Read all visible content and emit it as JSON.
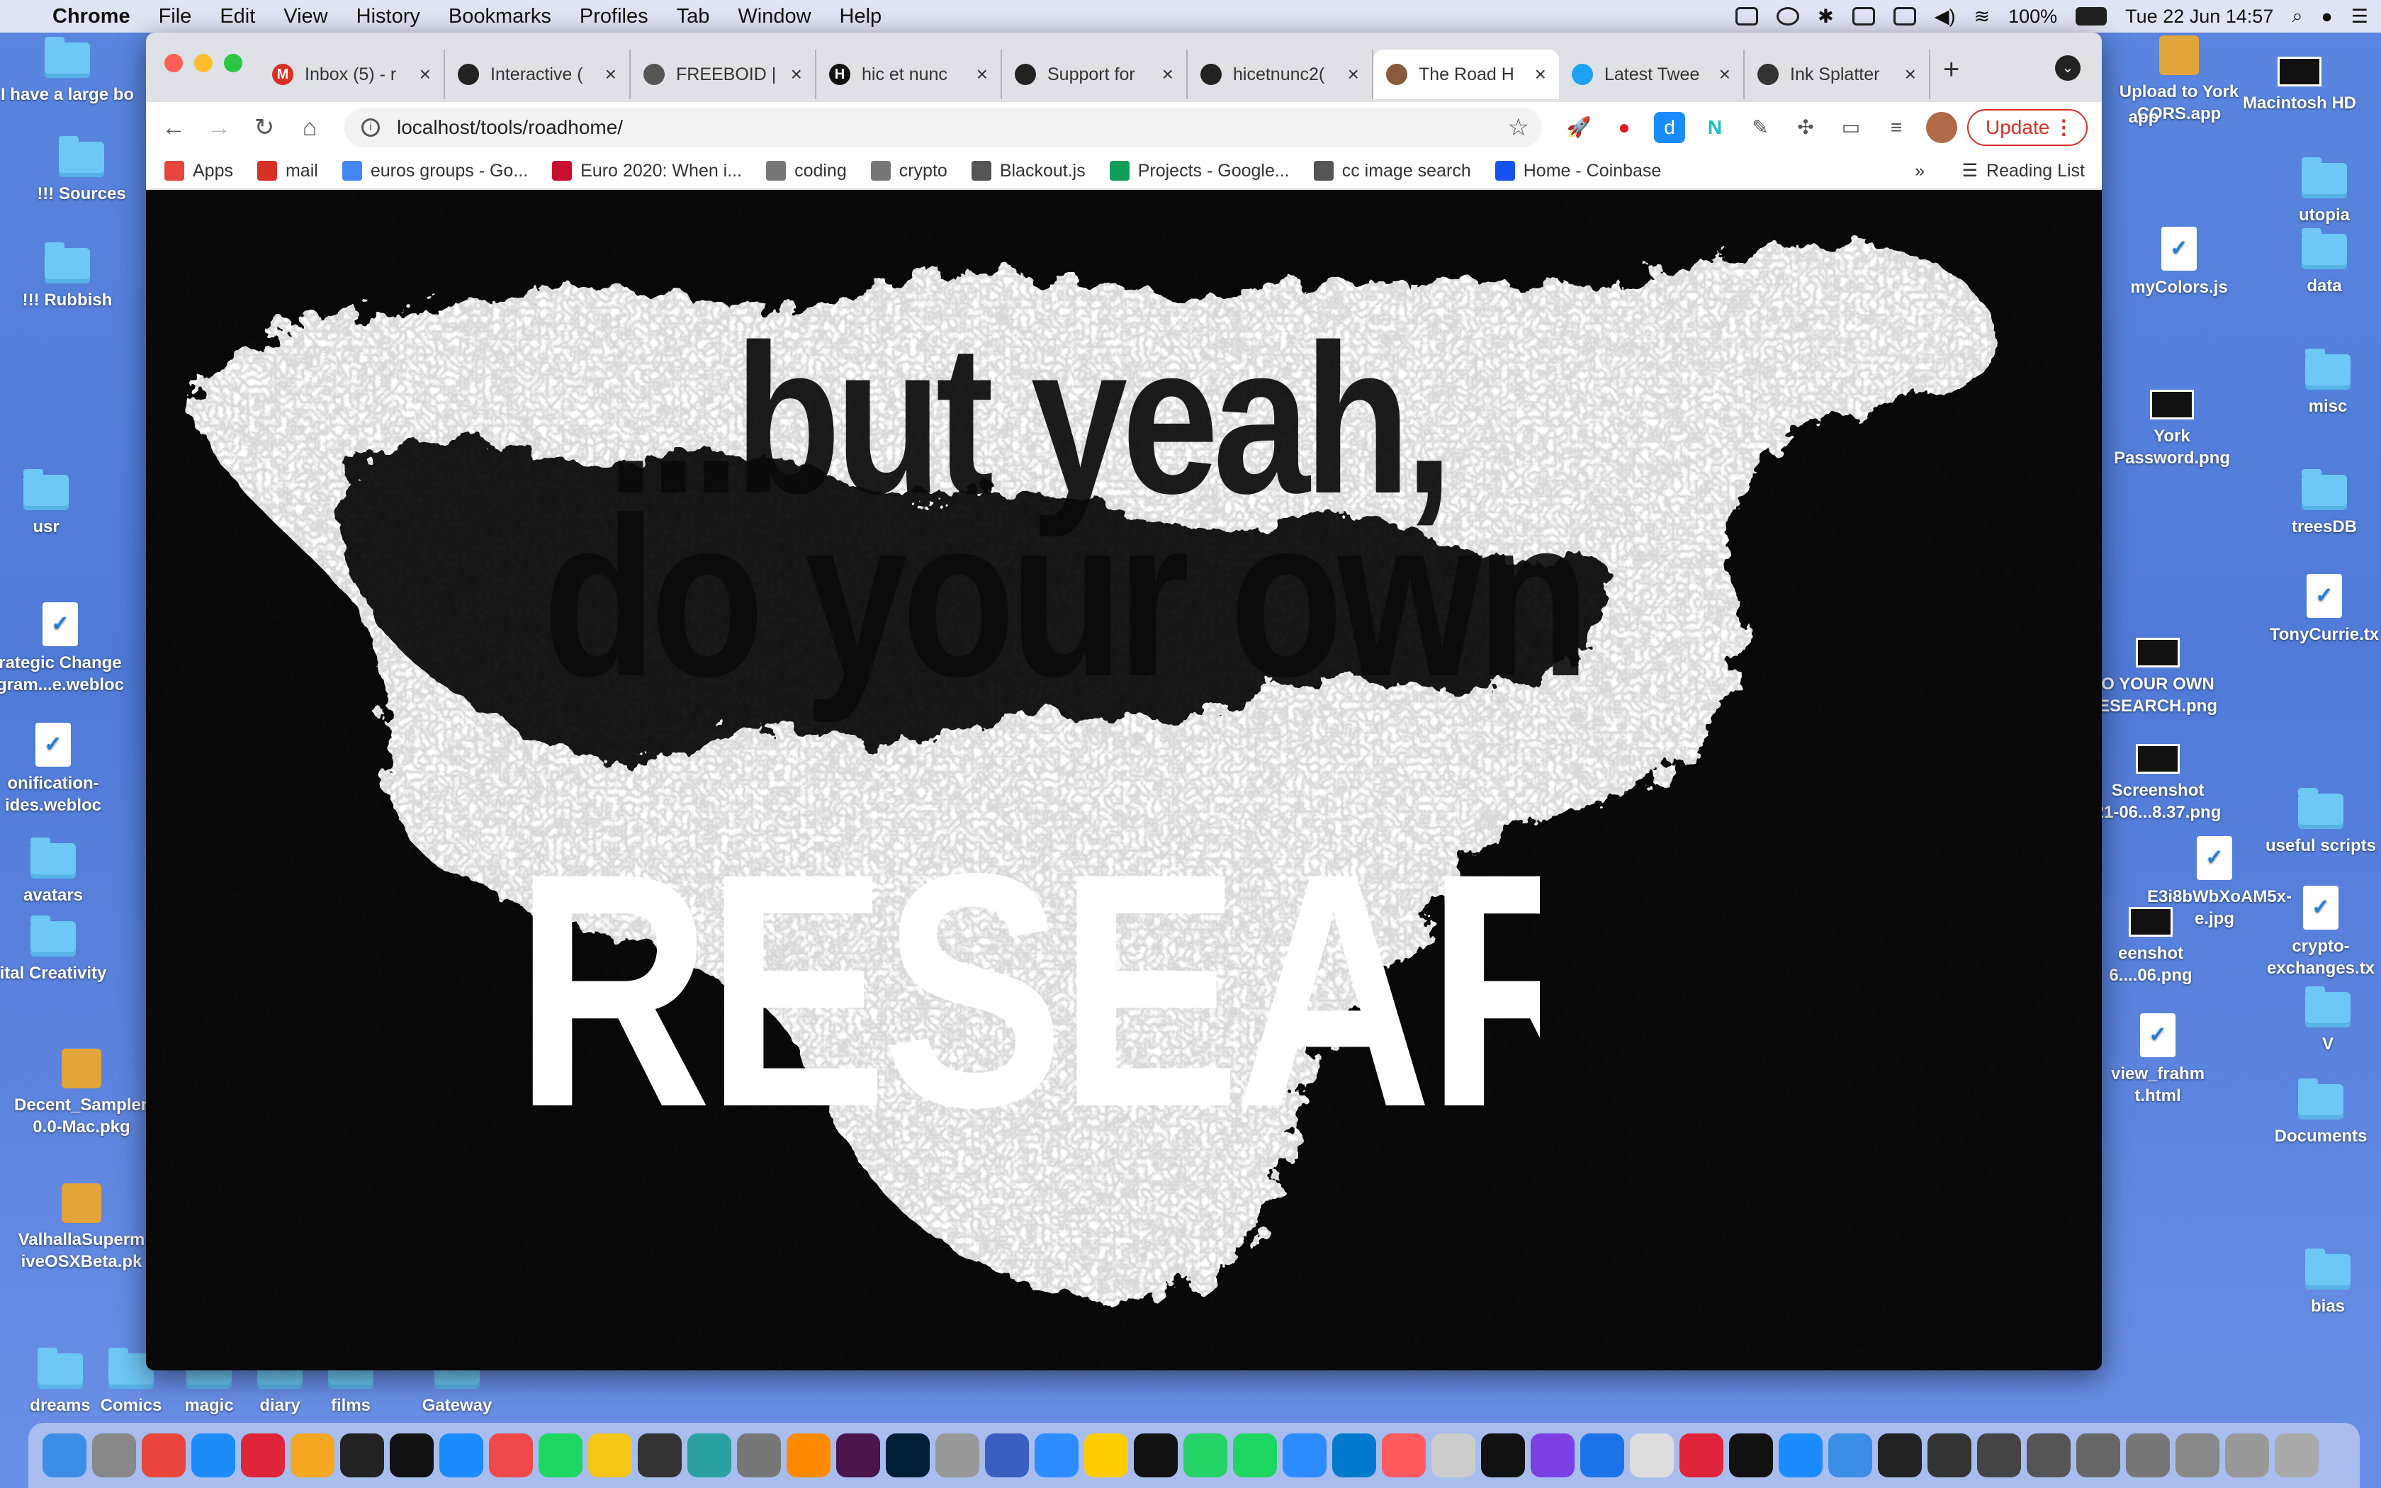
{
  "menubar": {
    "apple": "",
    "app_name": "Chrome",
    "items": [
      "File",
      "Edit",
      "View",
      "History",
      "Bookmarks",
      "Profiles",
      "Tab",
      "Window",
      "Help"
    ],
    "battery": "100%",
    "clock": "Tue 22 Jun  14:57"
  },
  "desktop": {
    "left": [
      {
        "label": "I have a large bo",
        "kind": "folder"
      },
      {
        "label": "!!! Sources",
        "kind": "folder"
      },
      {
        "label": "!!! Rubbish",
        "kind": "folder"
      },
      {
        "label": "usr",
        "kind": "folder"
      },
      {
        "label": "rategic Change\ngram...e.webloc",
        "kind": "doc"
      },
      {
        "label": "onification-\nides.webloc",
        "kind": "doc"
      },
      {
        "label": "avatars",
        "kind": "folder"
      },
      {
        "label": "ital Creativity",
        "kind": "folder"
      },
      {
        "label": "Decent_Sampler-\n0.0-Mac.pkg",
        "kind": "pkg"
      },
      {
        "label": "ValhallaSuperm\niveOSXBeta.pk",
        "kind": "pkg"
      },
      {
        "label": "dreams",
        "kind": "folder"
      },
      {
        "label": "Comics",
        "kind": "folder"
      },
      {
        "label": "magic",
        "kind": "folder"
      },
      {
        "label": "diary",
        "kind": "folder"
      },
      {
        "label": "films",
        "kind": "folder"
      },
      {
        "label": "Gateway",
        "kind": "folder"
      }
    ],
    "right": [
      {
        "label": "Upload to York\nCORS.app",
        "kind": "pkg"
      },
      {
        "label": "app",
        "kind": "none"
      },
      {
        "label": "Macintosh HD",
        "kind": "img"
      },
      {
        "label": "utopia",
        "kind": "folder"
      },
      {
        "label": "myColors.js",
        "kind": "doc"
      },
      {
        "label": "data",
        "kind": "folder"
      },
      {
        "label": "York\nPassword.png",
        "kind": "img"
      },
      {
        "label": "misc",
        "kind": "folder"
      },
      {
        "label": "treesDB",
        "kind": "folder"
      },
      {
        "label": "TonyCurrie.tx",
        "kind": "doc"
      },
      {
        "label": "O YOUR OWN\nESEARCH.png",
        "kind": "img"
      },
      {
        "label": "Screenshot\n21-06...8.37.png",
        "kind": "img"
      },
      {
        "label": "useful scripts",
        "kind": "folder"
      },
      {
        "label": "E3i8bWbXoAM5x-\ne.jpg",
        "kind": "doc"
      },
      {
        "label": "eenshot\n6....06.png",
        "kind": "img"
      },
      {
        "label": "crypto-\nexchanges.tx",
        "kind": "doc"
      },
      {
        "label": "V",
        "kind": "folder"
      },
      {
        "label": "view_frahm\nt.html",
        "kind": "doc"
      },
      {
        "label": "Documents",
        "kind": "folder"
      },
      {
        "label": "bias",
        "kind": "folder"
      }
    ]
  },
  "browser": {
    "tabs": [
      {
        "label": "Inbox (5) - r",
        "favicon": "M",
        "color": "#d93025",
        "active": false
      },
      {
        "label": "Interactive (",
        "favicon": "",
        "color": "#222",
        "active": false
      },
      {
        "label": "FREEBOID |",
        "favicon": "",
        "color": "#555",
        "active": false
      },
      {
        "label": "hic et nunc",
        "favicon": "H",
        "color": "#111",
        "active": false
      },
      {
        "label": "Support for",
        "favicon": "",
        "color": "#222",
        "active": false
      },
      {
        "label": "hicetnunc2(",
        "favicon": "",
        "color": "#222",
        "active": false
      },
      {
        "label": "The Road H",
        "favicon": "",
        "color": "#8a5a3c",
        "active": true
      },
      {
        "label": "Latest Twee",
        "favicon": "",
        "color": "#1da1f2",
        "active": false
      },
      {
        "label": "Ink Splatter",
        "favicon": "",
        "color": "#333",
        "active": false
      }
    ],
    "close_glyph": "×",
    "new_tab_glyph": "+",
    "url": "localhost/tools/roadhome/",
    "update_label": "Update",
    "bookmarks": [
      {
        "label": "Apps",
        "icon": "grid"
      },
      {
        "label": "mail",
        "icon": "M"
      },
      {
        "label": "euros groups - Go...",
        "icon": "G"
      },
      {
        "label": "Euro 2020: When i...",
        "icon": "flag"
      },
      {
        "label": "coding",
        "icon": "folder"
      },
      {
        "label": "crypto",
        "icon": "folder"
      },
      {
        "label": "Blackout.js",
        "icon": "globe"
      },
      {
        "label": "Projects - Google...",
        "icon": "sheet"
      },
      {
        "label": "cc image search",
        "icon": "globe"
      },
      {
        "label": "Home - Coinbase",
        "icon": "C"
      }
    ],
    "overflow": "»",
    "reading_list": "Reading List"
  },
  "page": {
    "line1": "...but yeah,",
    "line2": "do your own",
    "line3": "RESEARCH"
  },
  "colors": {
    "desktop": "#5a86e0",
    "page_bg": "#0a0a0a",
    "ink": "#ffffff",
    "update_red": "#d93025"
  }
}
